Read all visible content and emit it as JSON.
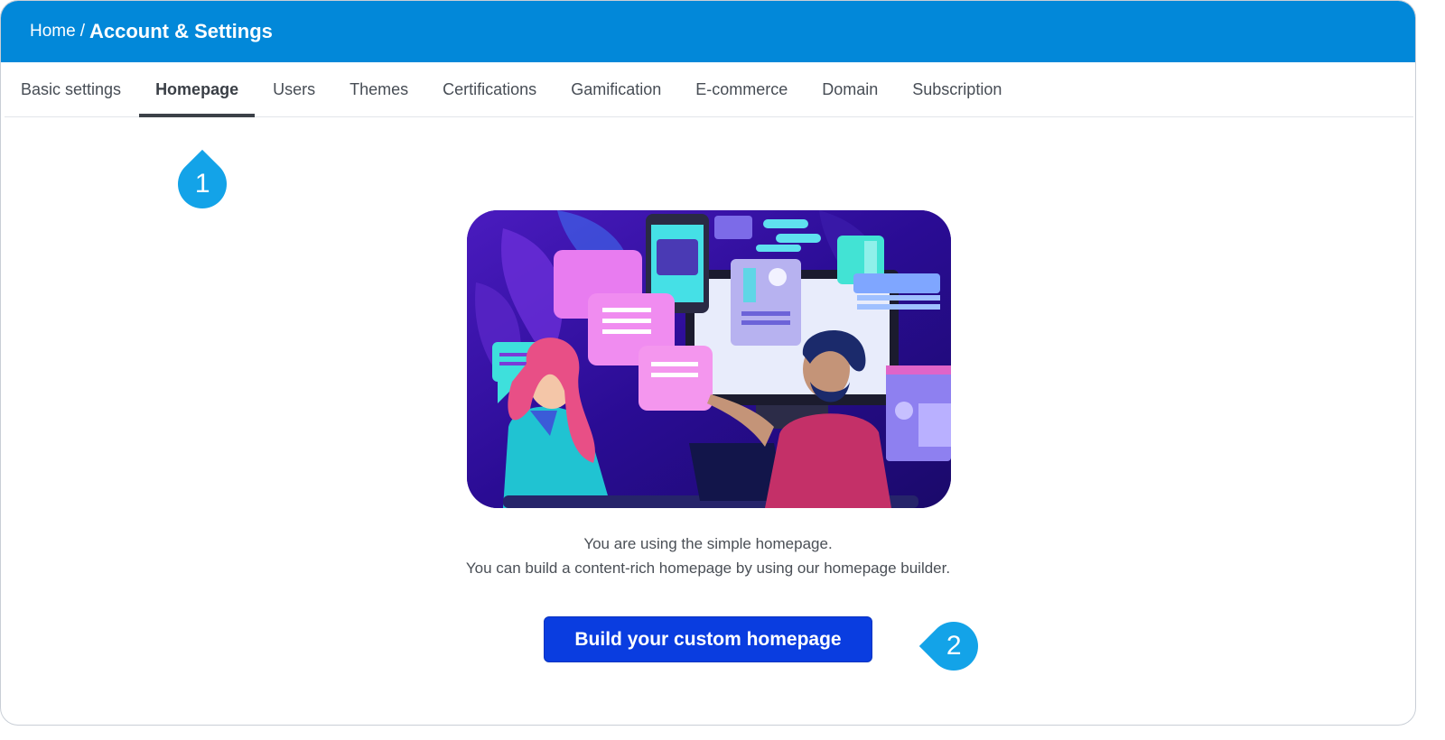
{
  "header": {
    "breadcrumb_home": "Home",
    "breadcrumb_sep": "/",
    "title": "Account & Settings",
    "bg_color": "#0288d9"
  },
  "tabs": [
    {
      "label": "Basic settings",
      "active": false
    },
    {
      "label": "Homepage",
      "active": true
    },
    {
      "label": "Users",
      "active": false
    },
    {
      "label": "Themes",
      "active": false
    },
    {
      "label": "Certifications",
      "active": false
    },
    {
      "label": "Gamification",
      "active": false
    },
    {
      "label": "E-commerce",
      "active": false
    },
    {
      "label": "Domain",
      "active": false
    },
    {
      "label": "Subscription",
      "active": false
    }
  ],
  "markers": {
    "first": "1",
    "second": "2",
    "color": "#13a3e8"
  },
  "main": {
    "line1": "You are using the simple homepage.",
    "line2": "You can build a content-rich homepage by using our homepage builder.",
    "cta_label": "Build your custom homepage",
    "cta_color": "#0a3de0"
  }
}
